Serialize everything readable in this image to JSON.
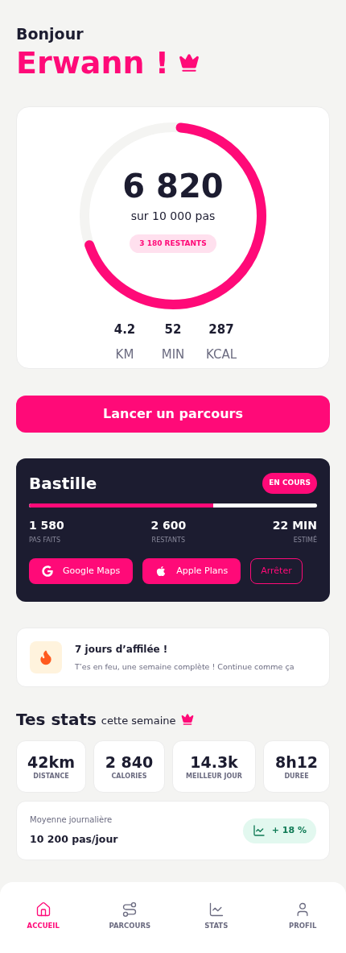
{
  "greeting": {
    "hello": "Bonjour",
    "name": "Erwann !"
  },
  "goal": {
    "steps": "6 820",
    "target": "sur 10 000 pas",
    "remaining": "3 180 RESTANTS",
    "metrics": [
      {
        "value": "4.2",
        "unit": "KM"
      },
      {
        "value": "52",
        "unit": "MIN"
      },
      {
        "value": "287",
        "unit": "KCAL"
      }
    ]
  },
  "start_button": "Lancer un parcours",
  "route": {
    "name": "Bastille",
    "status": "EN COURS",
    "level": 0.64,
    "figures": [
      {
        "value": "1 580",
        "label": "PAS FAITS"
      },
      {
        "value": "2 600",
        "label": "RESTANTS"
      },
      {
        "value": "22 MIN",
        "label": "ESTIMÉ"
      }
    ],
    "actions": [
      {
        "kind": "google",
        "label": "Google Maps"
      },
      {
        "kind": "apple",
        "label": "Apple Plans"
      },
      {
        "kind": "stop",
        "label": "Arrêter"
      }
    ]
  },
  "streak": {
    "title": "7 jours d’affilée !",
    "text": "T’es en feu, une semaine complète ! Continue comme ça"
  },
  "stats": {
    "title": "Tes stats",
    "subtitle": "cette semaine",
    "tiles": [
      {
        "value": "42km",
        "label": "DISTANCE"
      },
      {
        "value": "2 840",
        "label": "CALORIES"
      },
      {
        "value": "14.3k",
        "label": "MEILLEUR JOUR"
      },
      {
        "value": "8h12",
        "label": "DUREE"
      }
    ],
    "average": {
      "label": "Moyenne journalière",
      "value": "10 200 pas/jour",
      "trend": "+ 18 %"
    }
  },
  "nav": [
    {
      "kind": "home",
      "label": "ACCUEIL",
      "selected": true
    },
    {
      "kind": "route",
      "label": "PARCOURS",
      "selected": false
    },
    {
      "kind": "stats",
      "label": "STATS",
      "selected": false
    },
    {
      "kind": "profile",
      "label": "PROFIL",
      "selected": false
    }
  ]
}
